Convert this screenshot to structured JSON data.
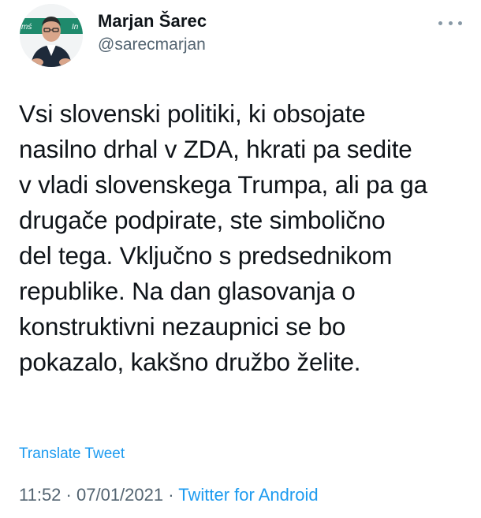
{
  "author": {
    "name": "Marjan Šarec",
    "handle": "@sarecmarjan",
    "avatar_banner_text_left": "mś",
    "avatar_banner_text_right": "In"
  },
  "tweet": {
    "text": "Vsi slovenski politiki, ki obsojate\nnasilno drhal v ZDA, hkrati pa sedite\nv vladi slovenskega Trumpa, ali pa ga\ndrugače podpirate, ste simbolično\ndel tega. Vključno s predsednikom\nrepublike. Na dan glasovanja o\nkonstruktivni nezaupnici se bo\npokazalo, kakšno družbo želite.",
    "translate_label": "Translate Tweet",
    "time": "11:52",
    "separator": "·",
    "date": "07/01/2021",
    "source": "Twitter for Android"
  },
  "icons": {
    "more": "more-horizontal-icon"
  },
  "colors": {
    "link": "#1d9bf0",
    "secondary_text": "#536471",
    "primary_text": "#0f1419",
    "avatar_banner": "#1f8a6c"
  }
}
